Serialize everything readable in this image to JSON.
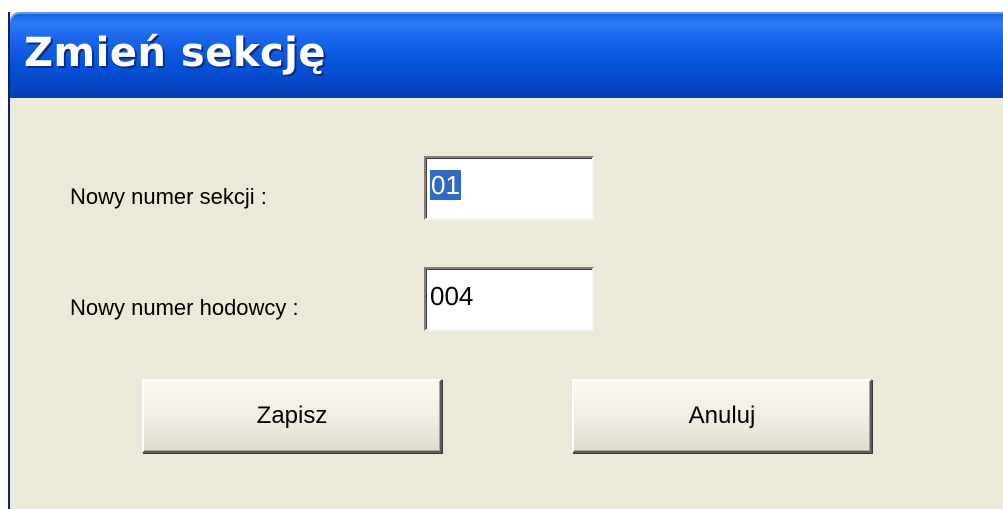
{
  "dialog": {
    "title": "Zmień sekcję"
  },
  "form": {
    "section_label": "Nowy numer sekcji :",
    "section_value": "01",
    "breeder_label": "Nowy numer hodowcy :",
    "breeder_value": "004"
  },
  "buttons": {
    "save_label": "Zapisz",
    "cancel_label": "Anuluj"
  },
  "colors": {
    "titlebar": "#0553D9",
    "window_bg": "#ECE9D8",
    "selection": "#316AC5"
  }
}
